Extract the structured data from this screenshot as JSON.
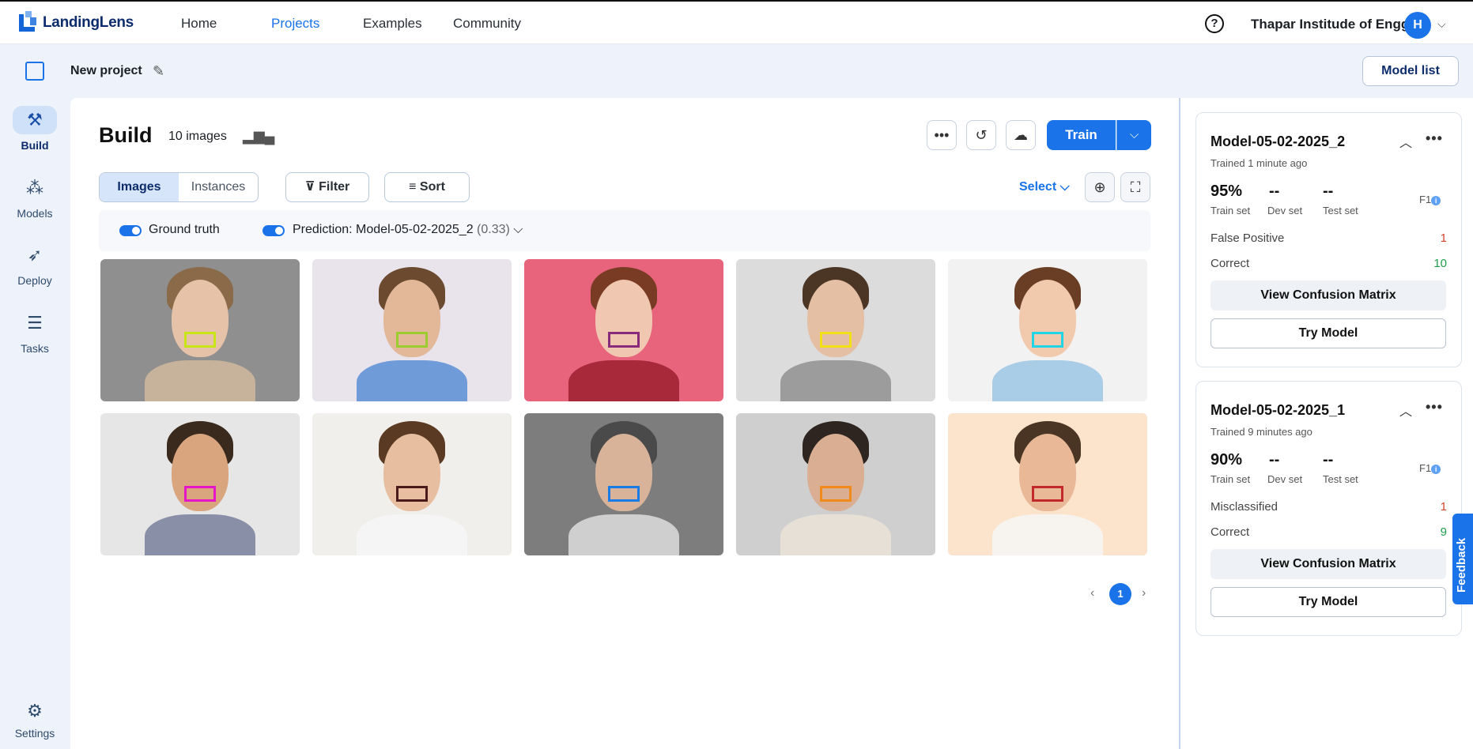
{
  "topnav": {
    "logo_text": "LandingLens",
    "links": [
      "Home",
      "Projects",
      "Examples",
      "Community"
    ],
    "org_name": "Thapar Institude of Engg.",
    "avatar_initial": "H"
  },
  "project": {
    "title": "New project",
    "model_list_label": "Model list"
  },
  "sidebar": {
    "items": [
      {
        "label": "Build",
        "icon": "build-icon"
      },
      {
        "label": "Models",
        "icon": "models-icon"
      },
      {
        "label": "Deploy",
        "icon": "rocket-icon"
      },
      {
        "label": "Tasks",
        "icon": "tasks-icon"
      },
      {
        "label": "Settings",
        "icon": "gear-icon"
      }
    ]
  },
  "build": {
    "title": "Build",
    "image_count": "10 images",
    "train_label": "Train",
    "tabs": [
      "Images",
      "Instances"
    ],
    "filter_label": "Filter",
    "sort_label": "Sort",
    "select_label": "Select",
    "ground_truth_label": "Ground truth",
    "prediction_label": "Prediction: Model-05-02-2025_2",
    "prediction_conf": "(0.33)",
    "page": "1"
  },
  "thumbnails": [
    {
      "bg": "#8f8f8f",
      "skin": "#e6c2a8",
      "hair": "#8a6a48",
      "shirt": "#c7b29b",
      "box": "#c8e617"
    },
    {
      "bg": "#e9e3ec",
      "skin": "#e2b899",
      "hair": "#6b4a30",
      "shirt": "#6f9bd8",
      "box": "#9ccc2f"
    },
    {
      "bg": "#e8637c",
      "skin": "#f0c7b0",
      "hair": "#7a3b24",
      "shirt": "#a82a3a",
      "box": "#8a2a7a"
    },
    {
      "bg": "#dcdcdc",
      "skin": "#e5bfa3",
      "hair": "#4b3626",
      "shirt": "#9c9c9c",
      "box": "#f0e015"
    },
    {
      "bg": "#f2f2f2",
      "skin": "#f1c9ad",
      "hair": "#6a3e24",
      "shirt": "#a9cde6",
      "box": "#21d5e6"
    },
    {
      "bg": "#e6e6e6",
      "skin": "#d9a57e",
      "hair": "#3a2a1e",
      "shirt": "#8a8fa8",
      "box": "#e615c8"
    },
    {
      "bg": "#f0efeb",
      "skin": "#e7bfa0",
      "hair": "#5a3a22",
      "shirt": "#f5f5f5",
      "box": "#4a1a1a"
    },
    {
      "bg": "#7d7d7d",
      "skin": "#d8b399",
      "hair": "#4a4a4a",
      "shirt": "#cfcfcf",
      "box": "#1a7ae6"
    },
    {
      "bg": "#cfcfcf",
      "skin": "#d9ae92",
      "hair": "#2f2520",
      "shirt": "#e6e0d6",
      "box": "#f08a1a"
    },
    {
      "bg": "#fbe3cc",
      "skin": "#e8b897",
      "hair": "#4a3424",
      "shirt": "#f7f4ef",
      "box": "#c22a2a"
    }
  ],
  "models": [
    {
      "name": "Model-05-02-2025_2",
      "trained": "Trained 1 minute ago",
      "train_set": "95%",
      "dev_set": "--",
      "test_set": "--",
      "train_lbl": "Train set",
      "dev_lbl": "Dev set",
      "test_lbl": "Test set",
      "f1": "F1",
      "row1_label": "False Positive",
      "row1_val": "1",
      "row2_label": "Correct",
      "row2_val": "10",
      "cm_label": "View Confusion Matrix",
      "try_label": "Try Model"
    },
    {
      "name": "Model-05-02-2025_1",
      "trained": "Trained 9 minutes ago",
      "train_set": "90%",
      "dev_set": "--",
      "test_set": "--",
      "train_lbl": "Train set",
      "dev_lbl": "Dev set",
      "test_lbl": "Test set",
      "f1": "F1",
      "row1_label": "Misclassified",
      "row1_val": "1",
      "row2_label": "Correct",
      "row2_val": "9",
      "cm_label": "View Confusion Matrix",
      "try_label": "Try Model"
    }
  ],
  "feedback_label": "Feedback",
  "colors": {
    "accent": "#1a73e8",
    "sidebar_bg": "#eef3fb"
  }
}
